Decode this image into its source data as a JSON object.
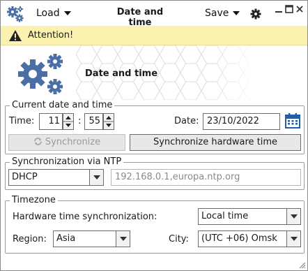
{
  "titlebar": {
    "app_icon": "gears-icon",
    "load_label": "Load",
    "title": "Date and time",
    "save_label": "Save",
    "settings_icon": "gear-icon",
    "controls": [
      "minimize-icon",
      "maximize-icon",
      "close-icon"
    ]
  },
  "attention": {
    "icon": "warning-icon",
    "text": "Attention!"
  },
  "hero": {
    "icon": "gears-icon",
    "title": "Date and time"
  },
  "current": {
    "group_title": "Current date and time",
    "time_label": "Time:",
    "hours": "11",
    "separator": ":",
    "minutes": "55",
    "date_label": "Date:",
    "date": "23/10/2022",
    "calendar_icon": "calendar-icon",
    "sync_label": "Synchronize",
    "sync_hw_label": "Synchronize hardware time"
  },
  "ntp": {
    "group_title": "Synchronization via NTP",
    "mode": "DHCP",
    "servers": "192.168.0.1,europa.ntp.org"
  },
  "timezone": {
    "group_title": "Timezone",
    "hw_sync_label": "Hardware time synchronization:",
    "hw_sync_value": "Local time",
    "region_label": "Region:",
    "region_value": "Asia",
    "city_label": "City:",
    "city_value": "(UTC +06) Omsk"
  },
  "colors": {
    "accent": "#4a6fa5",
    "attention_bg": "#fbf2b0",
    "calendar": "#1f5fa8"
  }
}
